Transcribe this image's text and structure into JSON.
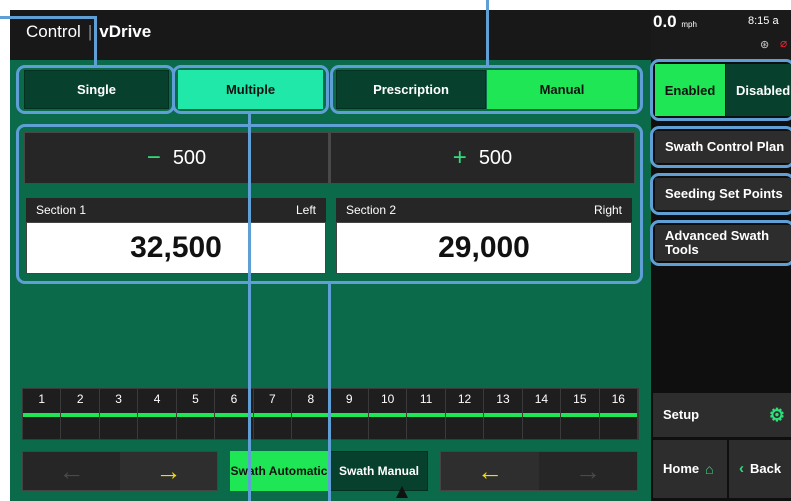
{
  "header": {
    "app": "Control",
    "section": "vDrive"
  },
  "status": {
    "speed": "0.0",
    "speed_unit": "mph",
    "time": "8:15 a"
  },
  "mode_buttons": {
    "single": "Single",
    "multiple": "Multiple",
    "prescription": "Prescription",
    "manual": "Manual"
  },
  "stepper": {
    "minus_symbol": "−",
    "minus_value": "500",
    "plus_symbol": "+",
    "plus_value": "500"
  },
  "sections": [
    {
      "name": "Section 1",
      "side": "Left",
      "value": "32,500"
    },
    {
      "name": "Section 2",
      "side": "Right",
      "value": "29,000"
    }
  ],
  "segments": [
    "1",
    "2",
    "3",
    "4",
    "5",
    "6",
    "7",
    "8",
    "9",
    "10",
    "11",
    "12",
    "13",
    "14",
    "15",
    "16"
  ],
  "bottom": {
    "left_arrow": "←",
    "right_arrow": "→",
    "swath_automatic": "Swath Automatic",
    "swath_manual": "Swath Manual"
  },
  "side_panel": {
    "enabled": "Enabled",
    "disabled": "Disabled",
    "swath_control_plan": "Swath Control Plan",
    "seeding_set_points": "Seeding Set Points",
    "advanced_swath_tools": "Advanced Swath Tools",
    "setup": "Setup",
    "home": "Home",
    "back": "Back"
  },
  "colors": {
    "background": "#0b6a4a",
    "accent_green": "#1ee654",
    "accent_cyan": "#1fe8a8",
    "highlight": "#5f9fd6"
  }
}
